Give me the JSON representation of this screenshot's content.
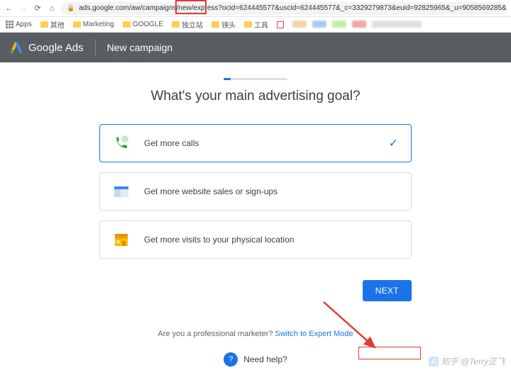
{
  "browser": {
    "url": "ads.google.com/aw/campaigns/new/express?ocid=624445577&uscid=624445577&_c=3329279873&euid=92825965&_u=9058569285&s",
    "bookmarks": [
      "Apps",
      "其他",
      "Marketing",
      "GOOGLE",
      "独立站",
      "镜头",
      "工具"
    ]
  },
  "header": {
    "product": "Google Ads",
    "page": "New campaign"
  },
  "main": {
    "question": "What's your main advertising goal?",
    "goals": [
      {
        "label": "Get more calls",
        "selected": true
      },
      {
        "label": "Get more website sales or sign-ups",
        "selected": false
      },
      {
        "label": "Get more visits to your physical location",
        "selected": false
      }
    ],
    "next": "NEXT",
    "switch_prompt": "Are you a professional marketer?",
    "switch_link": "Switch to Expert Mode",
    "help": "Need help?"
  },
  "watermark": "知乎 @Terry正飞"
}
